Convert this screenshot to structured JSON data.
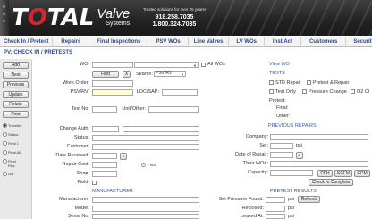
{
  "header": {
    "brand_main": "TOTAL",
    "brand_o": "O",
    "brand_valve": "Valve",
    "brand_systems": "Systems",
    "tagline": "Trusted solutions for over 25 years!",
    "phone1": "918.258.7035",
    "phone2": "1.800.324.7035"
  },
  "nav": [
    "Check In / Pretest",
    "Repairs",
    "Final Inspections",
    "PSV WOs",
    "Line Valves",
    "LV WOs",
    "Inst/Act",
    "Customers",
    "Security"
  ],
  "page_title": "PV: CHECK IN / PRETESTS",
  "left_buttons": [
    "Add",
    "Next",
    "Previous",
    "Update",
    "Delete",
    "Print"
  ],
  "status_filters": [
    {
      "label": "Traveler",
      "selected": true
    },
    {
      "label": "Status",
      "selected": false
    },
    {
      "label": "Final 1",
      "selected": false
    },
    {
      "label": "Final All",
      "selected": false
    },
    {
      "label": "Final Pick",
      "selected": false
    },
    {
      "label": "List",
      "selected": false
    }
  ],
  "form": {
    "wo_label": "WO:",
    "all_wos": "All WOs",
    "find_btn": "Find",
    "clear_btn": "X",
    "search_label": "Search:",
    "search_value": "PSV/RV",
    "work_order_label": "Work Order:",
    "psv_rv_label": "PSV/RV:",
    "loc_sap_label": "LOC/SAP:",
    "test_no_label": "Test No:",
    "unit_other_label": "Unit/Other:",
    "change_auth_label": "Change Auth:",
    "status_label": "Status:",
    "customer_label": "Customer:",
    "date_received_label": "Date Received:",
    "repair_cost_label": "Repair Cost:",
    "final_label": "Final",
    "shop_label": "Shop:",
    "field_label": "Field:"
  },
  "view_wo": {
    "title": "View WO",
    "tests": "TESTS",
    "std_repair": "STD Repair",
    "pretest_repair": "Pretest & Repair",
    "test_only": "Test Only",
    "pressure_change": "Pressure Change",
    "o2_clean": "O2 Cl",
    "pretest": "Pretest:",
    "final": "Final:",
    "other": "Other:"
  },
  "previous_repairs": {
    "title": "PREVIOUS REPAIRS",
    "company": "Company:",
    "set": "Set:",
    "set_unit": "psi",
    "date_of_repair": "Date of Repair:",
    "their_wo": "Their WO#:",
    "capacity": "Capacity:",
    "units": [
      "PPH",
      "SCFM",
      "GPM"
    ],
    "check_in_complete": "Check In Complete"
  },
  "manufacturer": {
    "title": "MANUFACTURER",
    "manufacturer": "Manufacturer:",
    "model": "Model:",
    "serial_no": "Serial No:"
  },
  "pretest_results": {
    "title": "PRETEST RESULTS",
    "set_pressure_found": "Set Pressure Found:",
    "reclosed": "Reclosed:",
    "leaked_at": "Leaked At:",
    "unit": "psi",
    "refresh": "Refresh"
  }
}
